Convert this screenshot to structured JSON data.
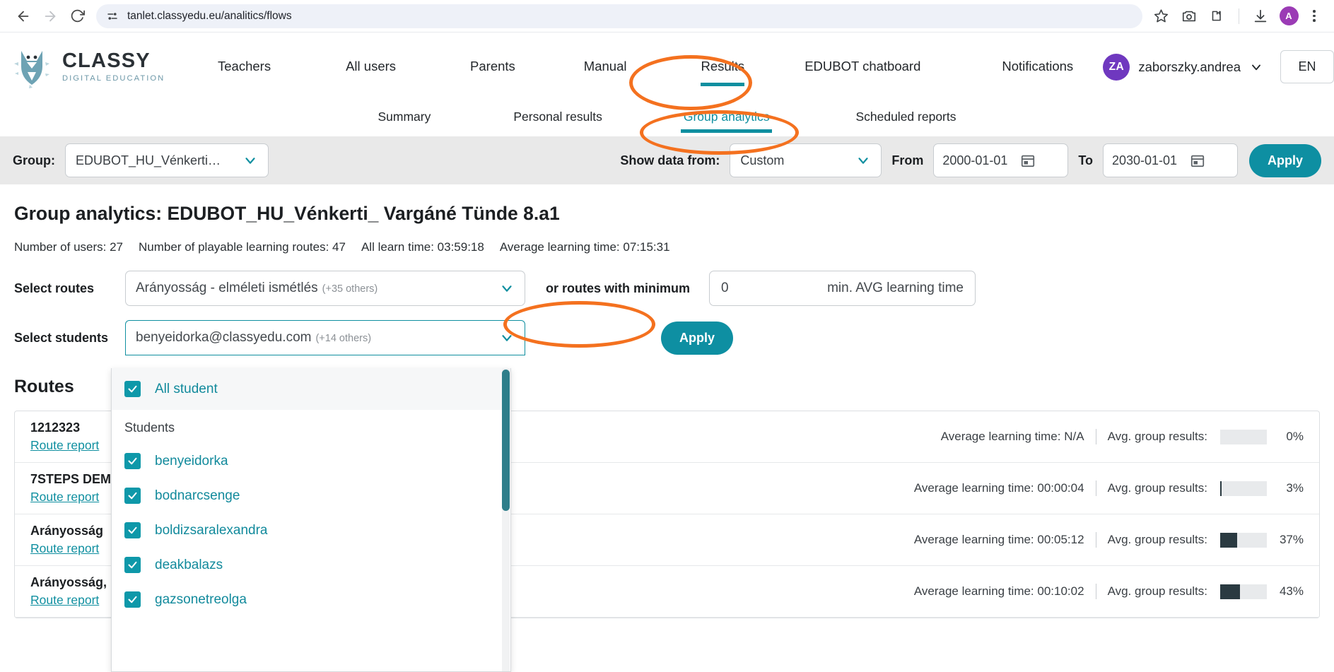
{
  "browser": {
    "url": "tanlet.classyedu.eu/analitics/flows",
    "back_icon": "back-arrow-icon",
    "forward_icon": "forward-arrow-icon",
    "reload_icon": "reload-icon",
    "site_info_icon": "site-settings-icon",
    "bookmark_icon": "star-icon",
    "screenshot_icon": "camera-icon",
    "extensions_icon": "extensions-icon",
    "download_icon": "download-icon",
    "profile_initial": "A",
    "menu_icon": "kebab-menu-icon"
  },
  "header": {
    "logo_title": "CLASSY",
    "logo_subtitle": "DIGITAL EDUCATION",
    "nav": [
      {
        "label": "Teachers",
        "active": false
      },
      {
        "label": "All users",
        "active": false
      },
      {
        "label": "Parents",
        "active": false
      },
      {
        "label": "Manual",
        "active": false
      },
      {
        "label": "Results",
        "active": true
      },
      {
        "label": "EDUBOT chatboard",
        "active": false
      },
      {
        "label": "Notifications",
        "active": false
      }
    ],
    "user": {
      "initials": "ZA",
      "name": "zaborszky.andrea"
    },
    "language": "EN"
  },
  "subnav": [
    {
      "label": "Summary",
      "active": false
    },
    {
      "label": "Personal results",
      "active": false
    },
    {
      "label": "Group analytics",
      "active": true
    },
    {
      "label": "Scheduled reports",
      "active": false
    }
  ],
  "filterbar": {
    "group_label": "Group:",
    "group_value": "EDUBOT_HU_Vénkerti…",
    "show_data_label": "Show data from:",
    "show_data_value": "Custom",
    "from_label": "From",
    "from_value": "2000-01-01",
    "to_label": "To",
    "to_value": "2030-01-01",
    "apply_label": "Apply"
  },
  "page": {
    "title": "Group analytics: EDUBOT_HU_Vénkerti_ Vargáné Tünde 8.a1",
    "stats": [
      "Number of users: 27",
      "Number of playable learning routes: 47",
      "All learn time: 03:59:18",
      "Average learning time: 07:15:31"
    ]
  },
  "filters": {
    "routes_label": "Select routes",
    "routes_value": "Arányosság - elméleti ismétlés",
    "routes_extra": "(+35 others)",
    "minimum_label": "or routes with minimum",
    "minimum_value": "0",
    "minimum_unit": "min. AVG learning time",
    "students_label": "Select students",
    "students_value": "benyeidorka@classyedu.com",
    "students_extra": "(+14 others)",
    "apply_label": "Apply"
  },
  "students_dropdown": {
    "all_label": "All student",
    "group_label": "Students",
    "items": [
      {
        "label": "benyeidorka",
        "checked": true
      },
      {
        "label": "bodnarcsenge",
        "checked": true
      },
      {
        "label": "boldizsaralexandra",
        "checked": true
      },
      {
        "label": "deakbalazs",
        "checked": true
      },
      {
        "label": "gazsonetreolga",
        "checked": true
      }
    ]
  },
  "routes_section": {
    "heading": "Routes",
    "report_link_label": "Route report",
    "avg_time_prefix": "Average learning time:",
    "avg_results_label": "Avg. group results:",
    "rows": [
      {
        "name": "1212323",
        "avg_learning_time": "N/A",
        "avg_group_results_pct": "0%",
        "bar_value": 0
      },
      {
        "name": "7STEPS DEM",
        "avg_learning_time": "00:00:04",
        "avg_group_results_pct": "3%",
        "bar_value": 3
      },
      {
        "name": "Arányosság",
        "avg_learning_time": "00:05:12",
        "avg_group_results_pct": "37%",
        "bar_value": 37
      },
      {
        "name": "Arányosság,",
        "avg_learning_time": "00:10:02",
        "avg_group_results_pct": "43%",
        "bar_value": 43
      }
    ]
  },
  "annotations": {
    "results_circle": "results-nav-highlight",
    "group_analytics_circle": "group-analytics-tab-highlight",
    "minimum_circle": "routes-minimum-highlight",
    "color": "#f4711f"
  },
  "colors": {
    "teal": "#0f8fa0",
    "avatar_purple": "#6f38bf",
    "filter_bg": "#e9e9e9",
    "bar_fill": "#2a3a41"
  }
}
